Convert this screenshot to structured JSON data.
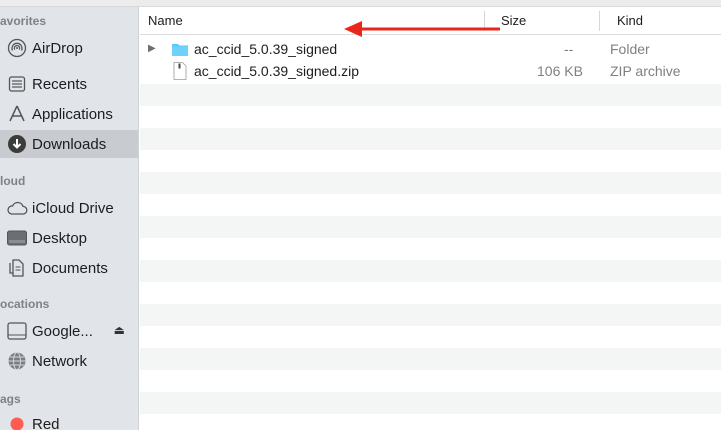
{
  "sidebar": {
    "favorites_header": "avorites",
    "icloud_header": "loud",
    "locations_header": "ocations",
    "tags_header": "ags",
    "items": [
      {
        "label": "AirDrop",
        "icon": "airdrop-icon"
      },
      {
        "label": "Recents",
        "icon": "recents-icon"
      },
      {
        "label": "Applications",
        "icon": "applications-icon"
      },
      {
        "label": "Downloads",
        "icon": "downloads-icon",
        "selected": true
      },
      {
        "label": "iCloud Drive",
        "icon": "icloud-icon"
      },
      {
        "label": "Desktop",
        "icon": "desktop-icon"
      },
      {
        "label": "Documents",
        "icon": "documents-icon"
      },
      {
        "label": "Google...",
        "icon": "disk-icon",
        "eject": "⏏"
      },
      {
        "label": "Network",
        "icon": "network-icon"
      },
      {
        "label": "Red",
        "icon": "tag-red-icon",
        "color": "#ff5b50"
      }
    ]
  },
  "columns": {
    "name": "Name",
    "size": "Size",
    "kind": "Kind"
  },
  "files": [
    {
      "name": "ac_ccid_5.0.39_signed",
      "size": "--",
      "kind": "Folder",
      "icon": "folder-icon",
      "expandable": true
    },
    {
      "name": "ac_ccid_5.0.39_signed.zip",
      "size": "106 KB",
      "kind": "ZIP archive",
      "icon": "zip-file-icon",
      "expandable": false
    }
  ],
  "colors": {
    "folder": "#5ac8fa",
    "arrow": "#e8261c",
    "selected": "#c8cbd0",
    "sidebar": "#e1e5ea",
    "stripe": "#f4f5f5"
  }
}
